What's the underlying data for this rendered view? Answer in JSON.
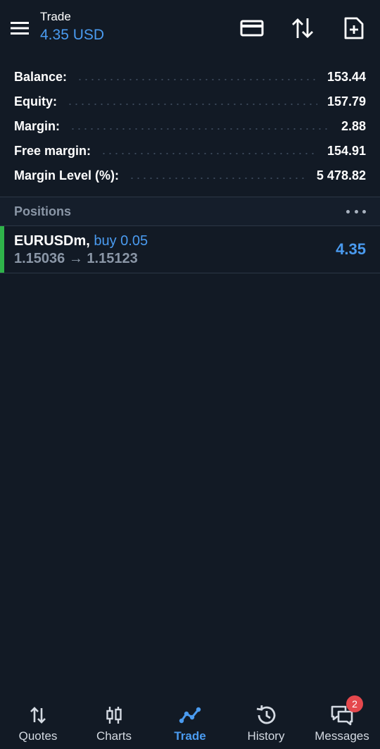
{
  "header": {
    "title": "Trade",
    "profit": "4.35 USD"
  },
  "summary": [
    {
      "label": "Balance:",
      "value": "153.44"
    },
    {
      "label": "Equity:",
      "value": "157.79"
    },
    {
      "label": "Margin:",
      "value": "2.88"
    },
    {
      "label": "Free margin:",
      "value": "154.91"
    },
    {
      "label": "Margin Level (%):",
      "value": "5 478.82"
    }
  ],
  "positions": {
    "title": "Positions",
    "items": [
      {
        "symbol": "EURUSDm,",
        "type": "buy 0.05",
        "prices": "1.15036 → 1.15123",
        "profit": "4.35"
      }
    ]
  },
  "nav": {
    "items": [
      {
        "label": "Quotes",
        "icon": "quotes-icon"
      },
      {
        "label": "Charts",
        "icon": "charts-icon"
      },
      {
        "label": "Trade",
        "icon": "trade-icon",
        "active": true
      },
      {
        "label": "History",
        "icon": "history-icon"
      },
      {
        "label": "Messages",
        "icon": "messages-icon",
        "badge": "2"
      }
    ]
  },
  "colors": {
    "background": "#121a25",
    "accent": "#4a9bf0",
    "buy_bar": "#2fb34a",
    "badge": "#e5484d"
  }
}
